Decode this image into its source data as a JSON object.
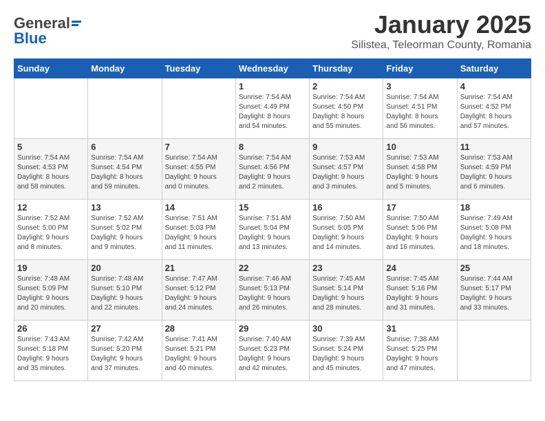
{
  "header": {
    "logo_general": "General",
    "logo_blue": "Blue",
    "month_title": "January 2025",
    "location": "Silistea, Teleorman County, Romania"
  },
  "days_of_week": [
    "Sunday",
    "Monday",
    "Tuesday",
    "Wednesday",
    "Thursday",
    "Friday",
    "Saturday"
  ],
  "weeks": [
    [
      {
        "day": "",
        "content": ""
      },
      {
        "day": "",
        "content": ""
      },
      {
        "day": "",
        "content": ""
      },
      {
        "day": "1",
        "content": "Sunrise: 7:54 AM\nSunset: 4:49 PM\nDaylight: 8 hours\nand 54 minutes."
      },
      {
        "day": "2",
        "content": "Sunrise: 7:54 AM\nSunset: 4:50 PM\nDaylight: 8 hours\nand 55 minutes."
      },
      {
        "day": "3",
        "content": "Sunrise: 7:54 AM\nSunset: 4:51 PM\nDaylight: 8 hours\nand 56 minutes."
      },
      {
        "day": "4",
        "content": "Sunrise: 7:54 AM\nSunset: 4:52 PM\nDaylight: 8 hours\nand 57 minutes."
      }
    ],
    [
      {
        "day": "5",
        "content": "Sunrise: 7:54 AM\nSunset: 4:53 PM\nDaylight: 8 hours\nand 58 minutes."
      },
      {
        "day": "6",
        "content": "Sunrise: 7:54 AM\nSunset: 4:54 PM\nDaylight: 8 hours\nand 59 minutes."
      },
      {
        "day": "7",
        "content": "Sunrise: 7:54 AM\nSunset: 4:55 PM\nDaylight: 9 hours\nand 0 minutes."
      },
      {
        "day": "8",
        "content": "Sunrise: 7:54 AM\nSunset: 4:56 PM\nDaylight: 9 hours\nand 2 minutes."
      },
      {
        "day": "9",
        "content": "Sunrise: 7:53 AM\nSunset: 4:57 PM\nDaylight: 9 hours\nand 3 minutes."
      },
      {
        "day": "10",
        "content": "Sunrise: 7:53 AM\nSunset: 4:58 PM\nDaylight: 9 hours\nand 5 minutes."
      },
      {
        "day": "11",
        "content": "Sunrise: 7:53 AM\nSunset: 4:59 PM\nDaylight: 9 hours\nand 6 minutes."
      }
    ],
    [
      {
        "day": "12",
        "content": "Sunrise: 7:52 AM\nSunset: 5:00 PM\nDaylight: 9 hours\nand 8 minutes."
      },
      {
        "day": "13",
        "content": "Sunrise: 7:52 AM\nSunset: 5:02 PM\nDaylight: 9 hours\nand 9 minutes."
      },
      {
        "day": "14",
        "content": "Sunrise: 7:51 AM\nSunset: 5:03 PM\nDaylight: 9 hours\nand 11 minutes."
      },
      {
        "day": "15",
        "content": "Sunrise: 7:51 AM\nSunset: 5:04 PM\nDaylight: 9 hours\nand 13 minutes."
      },
      {
        "day": "16",
        "content": "Sunrise: 7:50 AM\nSunset: 5:05 PM\nDaylight: 9 hours\nand 14 minutes."
      },
      {
        "day": "17",
        "content": "Sunrise: 7:50 AM\nSunset: 5:06 PM\nDaylight: 9 hours\nand 16 minutes."
      },
      {
        "day": "18",
        "content": "Sunrise: 7:49 AM\nSunset: 5:08 PM\nDaylight: 9 hours\nand 18 minutes."
      }
    ],
    [
      {
        "day": "19",
        "content": "Sunrise: 7:48 AM\nSunset: 5:09 PM\nDaylight: 9 hours\nand 20 minutes."
      },
      {
        "day": "20",
        "content": "Sunrise: 7:48 AM\nSunset: 5:10 PM\nDaylight: 9 hours\nand 22 minutes."
      },
      {
        "day": "21",
        "content": "Sunrise: 7:47 AM\nSunset: 5:12 PM\nDaylight: 9 hours\nand 24 minutes."
      },
      {
        "day": "22",
        "content": "Sunrise: 7:46 AM\nSunset: 5:13 PM\nDaylight: 9 hours\nand 26 minutes."
      },
      {
        "day": "23",
        "content": "Sunrise: 7:45 AM\nSunset: 5:14 PM\nDaylight: 9 hours\nand 28 minutes."
      },
      {
        "day": "24",
        "content": "Sunrise: 7:45 AM\nSunset: 5:16 PM\nDaylight: 9 hours\nand 31 minutes."
      },
      {
        "day": "25",
        "content": "Sunrise: 7:44 AM\nSunset: 5:17 PM\nDaylight: 9 hours\nand 33 minutes."
      }
    ],
    [
      {
        "day": "26",
        "content": "Sunrise: 7:43 AM\nSunset: 5:18 PM\nDaylight: 9 hours\nand 35 minutes."
      },
      {
        "day": "27",
        "content": "Sunrise: 7:42 AM\nSunset: 5:20 PM\nDaylight: 9 hours\nand 37 minutes."
      },
      {
        "day": "28",
        "content": "Sunrise: 7:41 AM\nSunset: 5:21 PM\nDaylight: 9 hours\nand 40 minutes."
      },
      {
        "day": "29",
        "content": "Sunrise: 7:40 AM\nSunset: 5:23 PM\nDaylight: 9 hours\nand 42 minutes."
      },
      {
        "day": "30",
        "content": "Sunrise: 7:39 AM\nSunset: 5:24 PM\nDaylight: 9 hours\nand 45 minutes."
      },
      {
        "day": "31",
        "content": "Sunrise: 7:38 AM\nSunset: 5:25 PM\nDaylight: 9 hours\nand 47 minutes."
      },
      {
        "day": "",
        "content": ""
      }
    ]
  ]
}
